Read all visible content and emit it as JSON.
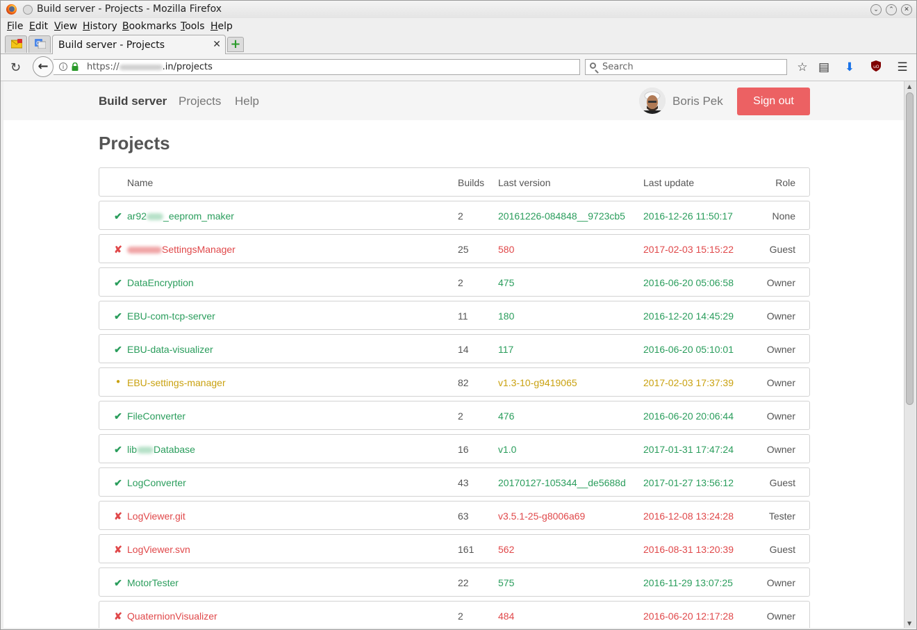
{
  "window": {
    "title": "Build server - Projects - Mozilla Firefox"
  },
  "menu": [
    "File",
    "Edit",
    "View",
    "History",
    "Bookmarks",
    "Tools",
    "Help"
  ],
  "tabs": {
    "active_title": "Build server - Projects",
    "close_glyph": "✕",
    "new_tab_glyph": "+"
  },
  "nav": {
    "url_prefix": "https://",
    "url_suffix": ".in/projects",
    "search_placeholder": "Search"
  },
  "site": {
    "brand": "Build server",
    "links": [
      "Projects",
      "Help"
    ],
    "user_name": "Boris Pek",
    "signout_label": "Sign out"
  },
  "page": {
    "title": "Projects"
  },
  "table": {
    "headers": {
      "name": "Name",
      "builds": "Builds",
      "version": "Last version",
      "update": "Last update",
      "role": "Role"
    },
    "status_glyphs": {
      "ok": "✔",
      "fail": "✘",
      "pending": "●"
    },
    "status_colors": {
      "ok": "#2a9d5c",
      "fail": "#e0484a",
      "pending": "#c9a10f"
    },
    "rows": [
      {
        "status": "ok",
        "name_pre": "ar92",
        "name_blur": true,
        "name_post": "_eeprom_maker",
        "builds": "2",
        "version": "20161226-084848__9723cb5",
        "update": "2016-12-26 11:50:17",
        "role": "None"
      },
      {
        "status": "fail",
        "name_pre": "",
        "name_blur": true,
        "name_post": "SettingsManager",
        "builds": "25",
        "version": "580",
        "update": "2017-02-03 15:15:22",
        "role": "Guest"
      },
      {
        "status": "ok",
        "name_pre": "DataEncryption",
        "name_blur": false,
        "name_post": "",
        "builds": "2",
        "version": "475",
        "update": "2016-06-20 05:06:58",
        "role": "Owner"
      },
      {
        "status": "ok",
        "name_pre": "EBU-com-tcp-server",
        "name_blur": false,
        "name_post": "",
        "builds": "11",
        "version": "180",
        "update": "2016-12-20 14:45:29",
        "role": "Owner"
      },
      {
        "status": "ok",
        "name_pre": "EBU-data-visualizer",
        "name_blur": false,
        "name_post": "",
        "builds": "14",
        "version": "117",
        "update": "2016-06-20 05:10:01",
        "role": "Owner"
      },
      {
        "status": "pending",
        "name_pre": "EBU-settings-manager",
        "name_blur": false,
        "name_post": "",
        "builds": "82",
        "version": "v1.3-10-g9419065",
        "update": "2017-02-03 17:37:39",
        "role": "Owner"
      },
      {
        "status": "ok",
        "name_pre": "FileConverter",
        "name_blur": false,
        "name_post": "",
        "builds": "2",
        "version": "476",
        "update": "2016-06-20 20:06:44",
        "role": "Owner"
      },
      {
        "status": "ok",
        "name_pre": "lib",
        "name_blur": true,
        "name_post": "Database",
        "builds": "16",
        "version": "v1.0",
        "update": "2017-01-31 17:47:24",
        "role": "Owner"
      },
      {
        "status": "ok",
        "name_pre": "LogConverter",
        "name_blur": false,
        "name_post": "",
        "builds": "43",
        "version": "20170127-105344__de5688d",
        "update": "2017-01-27 13:56:12",
        "role": "Guest"
      },
      {
        "status": "fail",
        "name_pre": "LogViewer.git",
        "name_blur": false,
        "name_post": "",
        "builds": "63",
        "version": "v3.5.1-25-g8006a69",
        "update": "2016-12-08 13:24:28",
        "role": "Tester"
      },
      {
        "status": "fail",
        "name_pre": "LogViewer.svn",
        "name_blur": false,
        "name_post": "",
        "builds": "161",
        "version": "562",
        "update": "2016-08-31 13:20:39",
        "role": "Guest"
      },
      {
        "status": "ok",
        "name_pre": "MotorTester",
        "name_blur": false,
        "name_post": "",
        "builds": "22",
        "version": "575",
        "update": "2016-11-29 13:07:25",
        "role": "Owner"
      },
      {
        "status": "fail",
        "name_pre": "QuaternionVisualizer",
        "name_blur": false,
        "name_post": "",
        "builds": "2",
        "version": "484",
        "update": "2016-06-20 12:17:28",
        "role": "Owner"
      }
    ]
  }
}
